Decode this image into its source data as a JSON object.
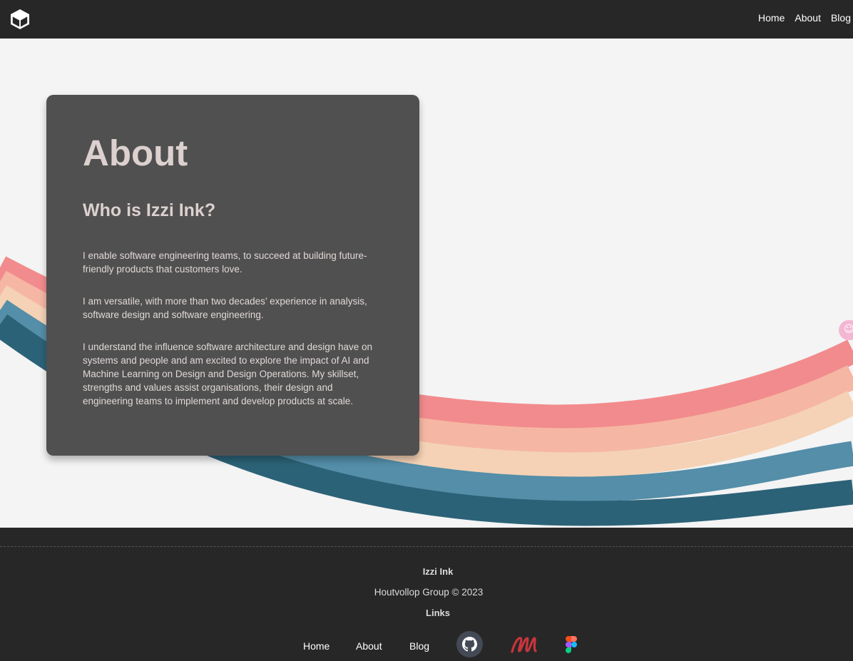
{
  "header": {
    "logo_icon": "cube-logo-icon",
    "nav": [
      {
        "label": "Home"
      },
      {
        "label": "About"
      },
      {
        "label": "Blog"
      }
    ]
  },
  "main": {
    "title": "About",
    "subtitle": "Who is Izzi Ink?",
    "paragraphs": [
      "I enable software engineering teams, to succeed at building future-friendly products that customers love.",
      "I am versatile, with more than two decades’ experience in analysis, software design and software engineering.",
      "I understand the influence software architecture and design have on systems and people and am excited to explore the impact of AI and Machine Learning on Design and Design Operations. My skillset, strengths and values assist organisations, their design and engineering teams to implement and develop products at scale."
    ],
    "rainbow_colors": [
      "#f28b8d",
      "#f5b7a3",
      "#f5d2b5",
      "#548ea8",
      "#2c6277"
    ],
    "side_widget_icon": "assistant-icon"
  },
  "footer": {
    "name": "Izzi Ink",
    "copyright": "Houtvollop Group © 2023",
    "links_heading": "Links",
    "nav": [
      {
        "label": "Home"
      },
      {
        "label": "About"
      },
      {
        "label": "Blog"
      }
    ],
    "social_icons": [
      "github-icon",
      "medium-icon",
      "figma-icon"
    ]
  }
}
